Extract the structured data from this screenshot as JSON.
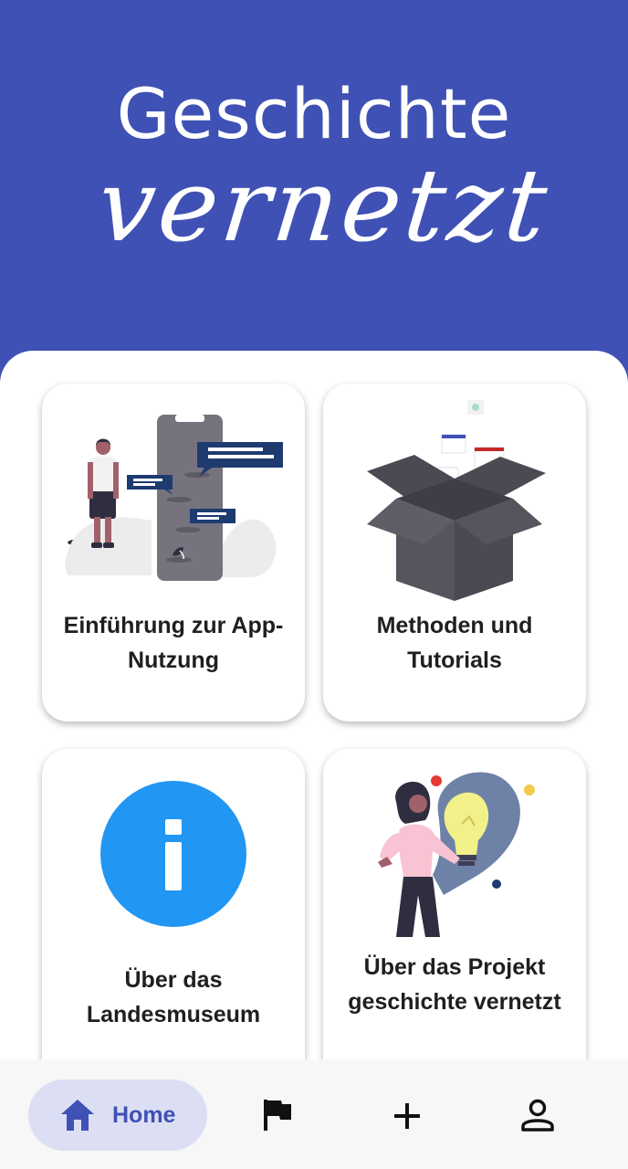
{
  "header": {
    "title_line1": "Geschichte",
    "title_line2": "vernetzt"
  },
  "cards": [
    {
      "label": "Einführung zur App-\nNutzung",
      "illustration": "person-with-phone-chat-illustration"
    },
    {
      "label": "Methoden und\nTutorials",
      "illustration": "open-box-documents-illustration"
    },
    {
      "label": "Über das\nLandesmuseum",
      "illustration": "info-icon"
    },
    {
      "label": "Über das Projekt\ngeschichte vernetzt",
      "illustration": "woman-lightbulb-illustration"
    }
  ],
  "nav": {
    "home_label": "Home",
    "items": [
      "home-icon",
      "flag-icon",
      "plus-icon",
      "person-icon"
    ]
  },
  "colors": {
    "primary": "#3f51b5",
    "info_blue": "#2196f3",
    "nav_active_bg": "#dcdff3"
  }
}
